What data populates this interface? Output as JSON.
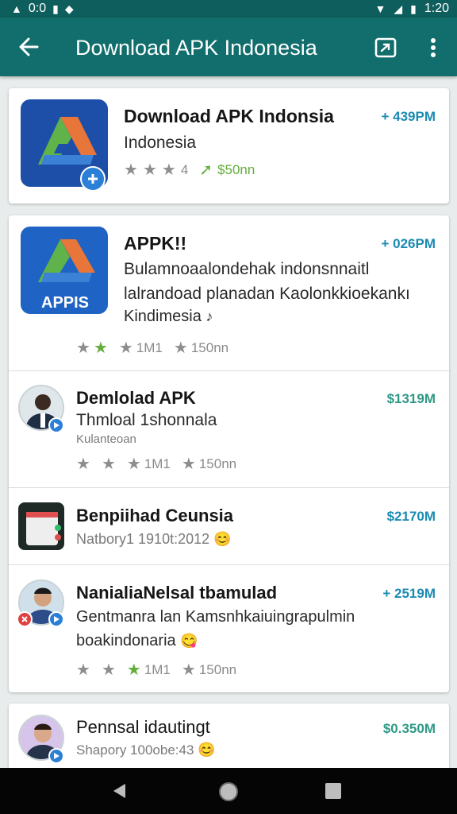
{
  "status_bar": {
    "time": "1:20",
    "left_text": "0:0"
  },
  "app_bar": {
    "title": "Download APK Indonesia"
  },
  "featured": {
    "title": "Download APK Indonsia",
    "subtitle": "Indonesia",
    "rating": "4",
    "downloads": "$50nn",
    "size": "+ 439PM"
  },
  "list": [
    {
      "title": "APPK!!",
      "desc1": "Bulamnoaalondehak indonsnnaitl",
      "desc2": "lalrandoad planadan Kaolonkkioekankı",
      "desc3": "Kindimesia",
      "icon_text": "APPIS",
      "rating_text": "1M1",
      "downloads": "150nn",
      "size": "+ 026PM"
    },
    {
      "title": "Demlolad APK",
      "desc1": "Thmloal 1shonnala",
      "desc2": "Kulanteoan",
      "rating_text": "1M1",
      "downloads": "150nn",
      "size": "$1319M"
    },
    {
      "title": "Benpiihad Ceunsia",
      "desc1": "Natbory1 1910t:2012",
      "size": "$2170M"
    },
    {
      "title": "NanialiaNelsal tbamulad",
      "desc1": "Gentmanra lan Kamsnhkaiuingrapulmin",
      "desc2": "boakindonaria",
      "rating_text": "1M1",
      "downloads": "150nn",
      "size": "+ 2519M"
    }
  ],
  "last": {
    "title": "Pennsal idautingt",
    "desc1": "Shapory 100obe:43",
    "size": "$0.350M"
  },
  "colors": {
    "app_bar": "#126e6c",
    "status_bar": "#0d5e5c",
    "size_blue": "#1b8bb2",
    "size_green": "#2f9a86",
    "star_green": "#63ad3b"
  },
  "icons": [
    "back-arrow-icon",
    "share-icon",
    "more-vert-icon",
    "star-icon",
    "download-arrow-icon",
    "nav-back-icon",
    "nav-home-icon",
    "nav-recent-icon"
  ]
}
